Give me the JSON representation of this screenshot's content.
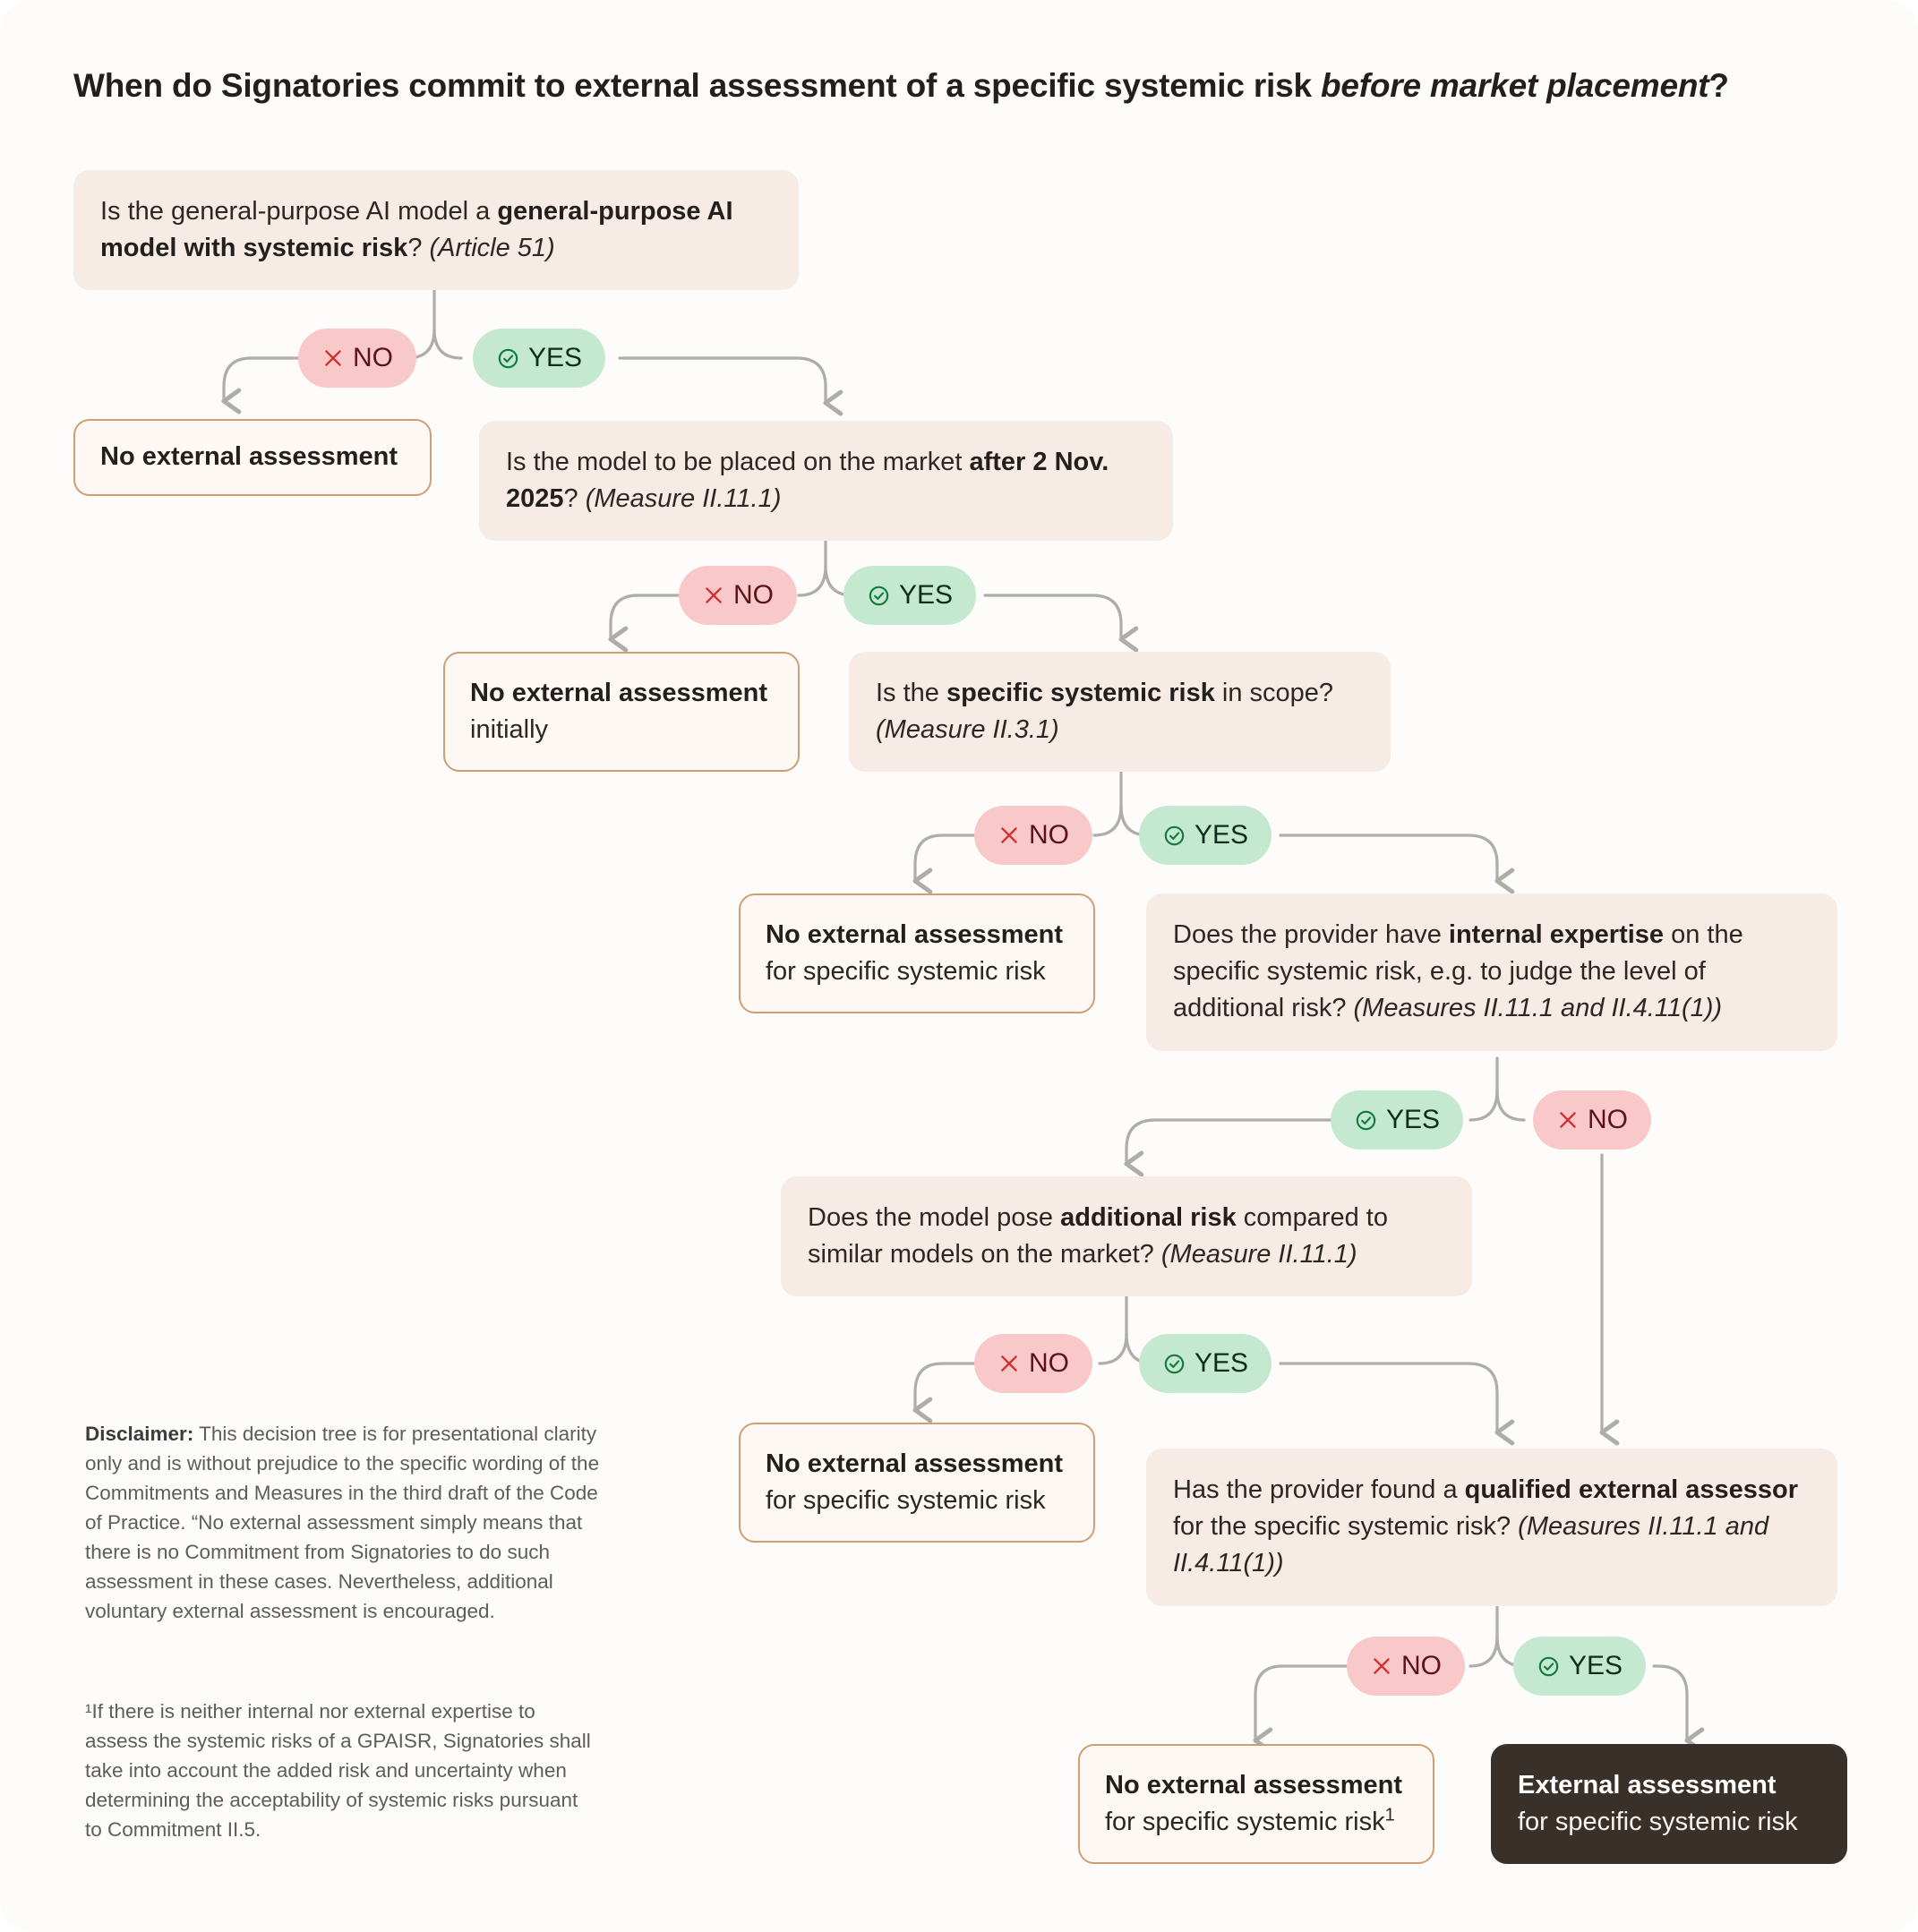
{
  "title": {
    "lead": "When do Signatories commit to external assessment of a specific systemic risk ",
    "emphasis": "before market placement",
    "tail": "?"
  },
  "colors": {
    "page_background": "#fdfcfa",
    "question_box_fill": "#f6ece5",
    "outcome_box_fill": "#fdf8f3",
    "outcome_box_border": "#cf9e72",
    "final_box_fill": "#3a302a",
    "yes_pill_fill": "#c5e8d0",
    "yes_pill_text": "#0e2d1c",
    "yes_icon": "#137a3e",
    "no_pill_fill": "#f9c9c9",
    "no_pill_text": "#5c1218",
    "no_icon": "#d32f2f",
    "connector": "#b0aca8",
    "title_text": "#241f1c",
    "note_text": "#5d5d5d"
  },
  "pills": {
    "yes_label": "YES",
    "no_label": "NO",
    "yes_icon_name": "check-circle-icon",
    "no_icon_name": "cross-icon"
  },
  "nodes": {
    "q1": {
      "id": "q1",
      "kind": "question",
      "part1": "Is the general-purpose AI model a ",
      "bold1": "general-purpose AI model with systemic risk",
      "part2": "? ",
      "ref": "(Article 51)"
    },
    "q2": {
      "id": "q2",
      "kind": "question",
      "part1": "Is the model to be placed on the market ",
      "bold1": "after 2 Nov. 2025",
      "part2": "? ",
      "ref": "(Measure II.11.1)"
    },
    "q3": {
      "id": "q3",
      "kind": "question",
      "part1": "Is the ",
      "bold1": "specific systemic risk",
      "part2": " in scope? ",
      "ref": "(Measure II.3.1)"
    },
    "q4": {
      "id": "q4",
      "kind": "question",
      "part1": "Does the provider have ",
      "bold1": "internal expertise",
      "part2": " on the specific systemic risk, e.g. to judge the level of additional risk? ",
      "ref": "(Measures II.11.1 and II.4.11(1))"
    },
    "q5": {
      "id": "q5",
      "kind": "question",
      "part1": "Does the model pose ",
      "bold1": "additional risk",
      "part2": " compared to similar models on the market? ",
      "ref": "(Measure II.11.1)"
    },
    "q6": {
      "id": "q6",
      "kind": "question",
      "part1": "Has the provider found a ",
      "bold1": "qualified external assessor",
      "part2": " for the specific systemic risk? ",
      "ref": "(Measures II.11.1 and II.4.11(1))"
    },
    "o1": {
      "id": "o1",
      "kind": "outcome",
      "headline": "No external assessment",
      "detail": ""
    },
    "o2": {
      "id": "o2",
      "kind": "outcome",
      "headline": "No external assessment",
      "detail": "initially"
    },
    "o3": {
      "id": "o3",
      "kind": "outcome",
      "headline": "No external assessment",
      "detail": "for specific systemic risk"
    },
    "o4": {
      "id": "o4",
      "kind": "outcome",
      "headline": "No external assessment",
      "detail": "for specific systemic risk"
    },
    "o5": {
      "id": "o5",
      "kind": "outcome",
      "headline": "No external assessment",
      "detail": "for specific systemic risk",
      "footnote_marker": "1"
    },
    "o6": {
      "id": "o6",
      "kind": "outcome-final",
      "headline": "External assessment",
      "detail": "for specific systemic risk"
    }
  },
  "notes": {
    "disclaimer_label": "Disclaimer:",
    "disclaimer_body": " This decision tree is for presentational clarity only and is without prejudice to the specific wording of the Commitments and Measures in the third draft of the Code of Practice. “No external assessment simply means that there is no Commitment from Signatories to do such assessment in these cases. Nevertheless, additional voluntary external assessment is encouraged.",
    "footnote": "¹If there is neither internal nor external expertise to assess the systemic risks of a GPAISR, Signatories shall take into account the added risk and uncertainty when determining the acceptability of systemic risks pursuant to Commitment II.5."
  }
}
